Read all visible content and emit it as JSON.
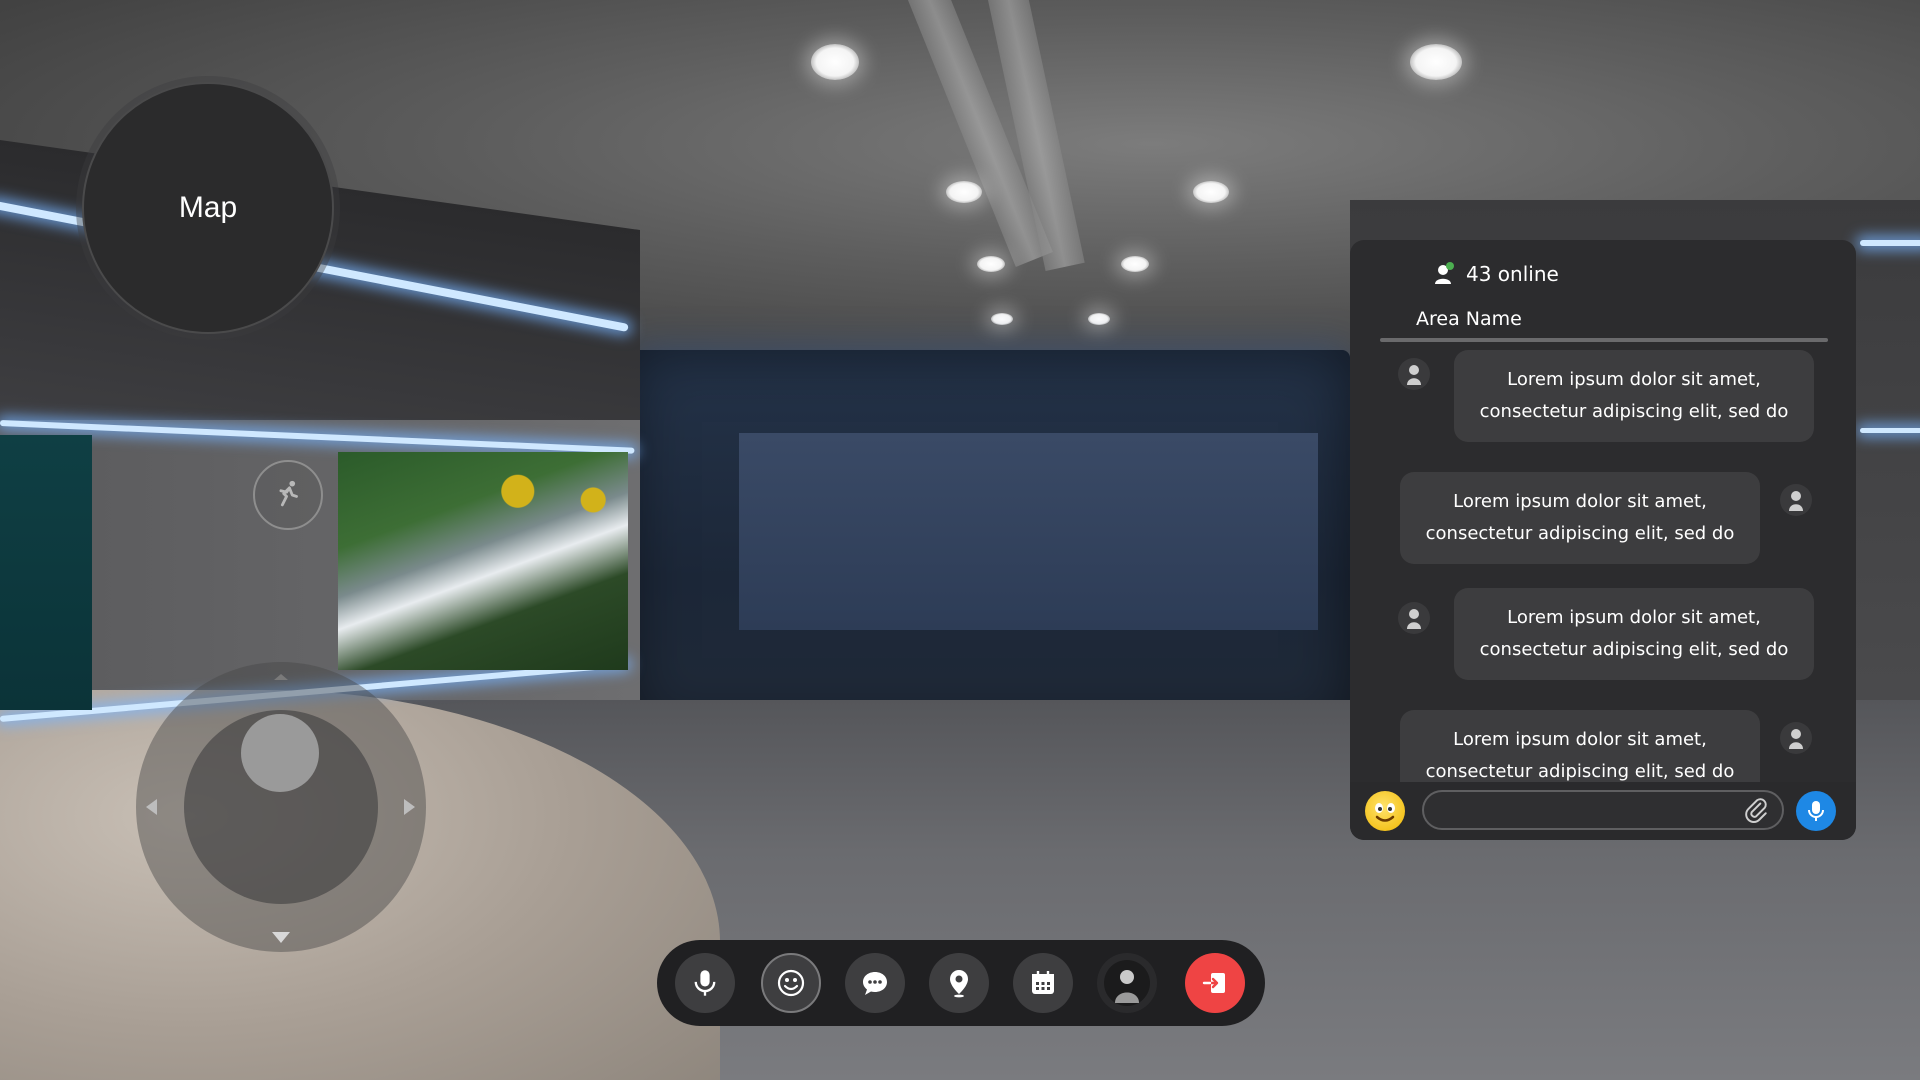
{
  "map": {
    "label": "Map"
  },
  "chat": {
    "online_count": "43 online",
    "area_name": "Area Name",
    "messages": [
      {
        "side": "left",
        "line1": "Lorem ipsum dolor sit amet,",
        "line2": "consectetur adipiscing elit, sed do"
      },
      {
        "side": "right",
        "line1": "Lorem ipsum dolor sit amet,",
        "line2": "consectetur adipiscing elit, sed do"
      },
      {
        "side": "left",
        "line1": "Lorem ipsum dolor sit amet,",
        "line2": "consectetur adipiscing elit, sed do"
      },
      {
        "side": "right",
        "line1": "Lorem ipsum dolor sit amet,",
        "line2": "consectetur adipiscing elit, sed do"
      }
    ],
    "input_value": ""
  },
  "toolbar": {
    "buttons": [
      "microphone-icon",
      "emoji-icon",
      "chat-icon",
      "location-pin-icon",
      "calendar-icon",
      "avatar-icon",
      "exit-icon"
    ]
  },
  "colors": {
    "accent_blue": "#1e88e5",
    "exit_red": "#ef4444",
    "panel_bg": "#2c2c2e",
    "bubble_bg": "#3d3d3f",
    "online_dot": "#4caf50"
  }
}
